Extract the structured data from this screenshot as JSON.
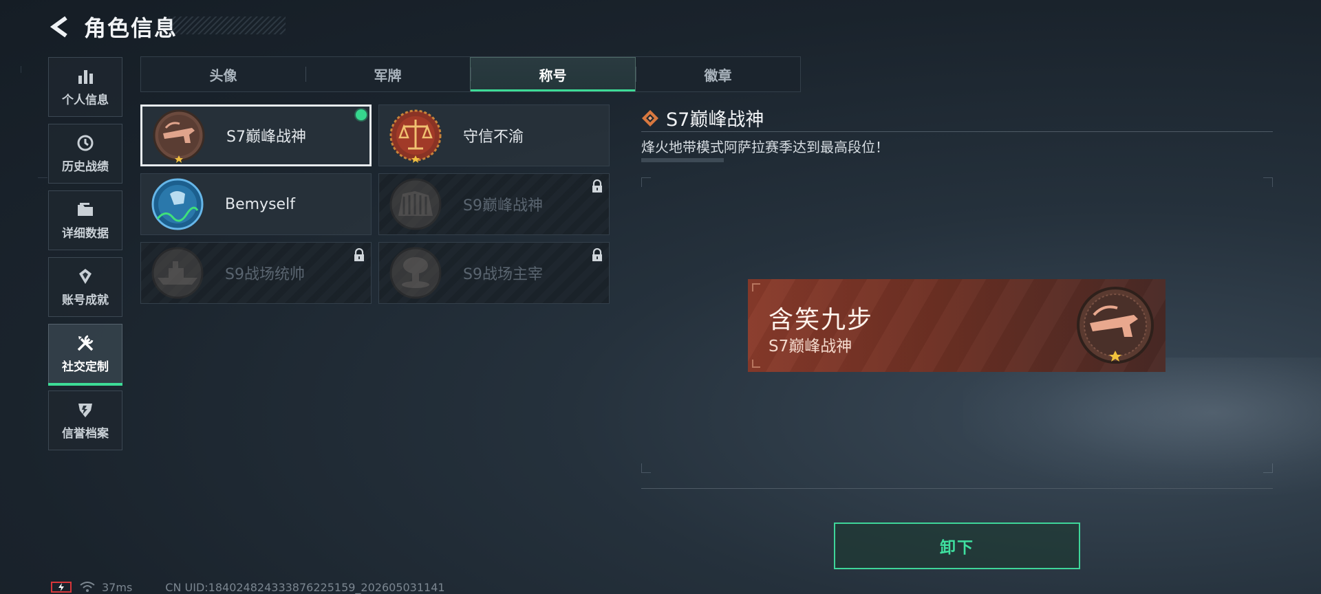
{
  "header": {
    "title": "角色信息",
    "back_icon": "chevron-left-icon"
  },
  "sidebar": {
    "items": [
      {
        "label": "个人信息",
        "icon": "bar-chart-icon",
        "active": false
      },
      {
        "label": "历史战绩",
        "icon": "history-icon",
        "active": false
      },
      {
        "label": "详细数据",
        "icon": "folder-icon",
        "active": false
      },
      {
        "label": "账号成就",
        "icon": "achievement-icon",
        "active": false
      },
      {
        "label": "社交定制",
        "icon": "tools-icon",
        "active": true
      },
      {
        "label": "信誉档案",
        "icon": "shield-icon",
        "active": false
      }
    ]
  },
  "tabs": [
    {
      "label": "头像",
      "active": false
    },
    {
      "label": "军牌",
      "active": false
    },
    {
      "label": "称号",
      "active": true
    },
    {
      "label": "徽章",
      "active": false
    }
  ],
  "titles": [
    {
      "name": "S7巅峰战神",
      "selected": true,
      "equipped": true,
      "locked": false,
      "medal": "crossbow-medal-icon"
    },
    {
      "name": "守信不渝",
      "selected": false,
      "equipped": false,
      "locked": false,
      "medal": "scales-medal-icon"
    },
    {
      "name": "Bemyself",
      "selected": false,
      "equipped": false,
      "locked": false,
      "medal": "signature-medal-icon"
    },
    {
      "name": "S9巅峰战神",
      "selected": false,
      "equipped": false,
      "locked": true,
      "medal": "fortress-medal-icon"
    },
    {
      "name": "S9战场统帅",
      "selected": false,
      "equipped": false,
      "locked": true,
      "medal": "warship-medal-icon"
    },
    {
      "name": "S9战场主宰",
      "selected": false,
      "equipped": false,
      "locked": true,
      "medal": "mushroom-cloud-medal-icon"
    }
  ],
  "detail": {
    "title": "S7巅峰战神",
    "description": "烽火地带模式阿萨拉赛季达到最高段位！",
    "title_icon": "diamond-icon"
  },
  "preview": {
    "player_name": "含笑九步",
    "title_text": "S7巅峰战神",
    "medal": "crossbow-medal-icon"
  },
  "actions": {
    "unequip_label": "卸下"
  },
  "status_bar": {
    "battery_icon": "battery-charging-icon",
    "wifi_icon": "wifi-icon",
    "ping": "37ms",
    "uid": "CN UID:184024824333876225159_202605031141"
  },
  "colors": {
    "accent_green": "#3ddc97",
    "banner_red": "#8a3b2b",
    "background": "#1a232c"
  }
}
